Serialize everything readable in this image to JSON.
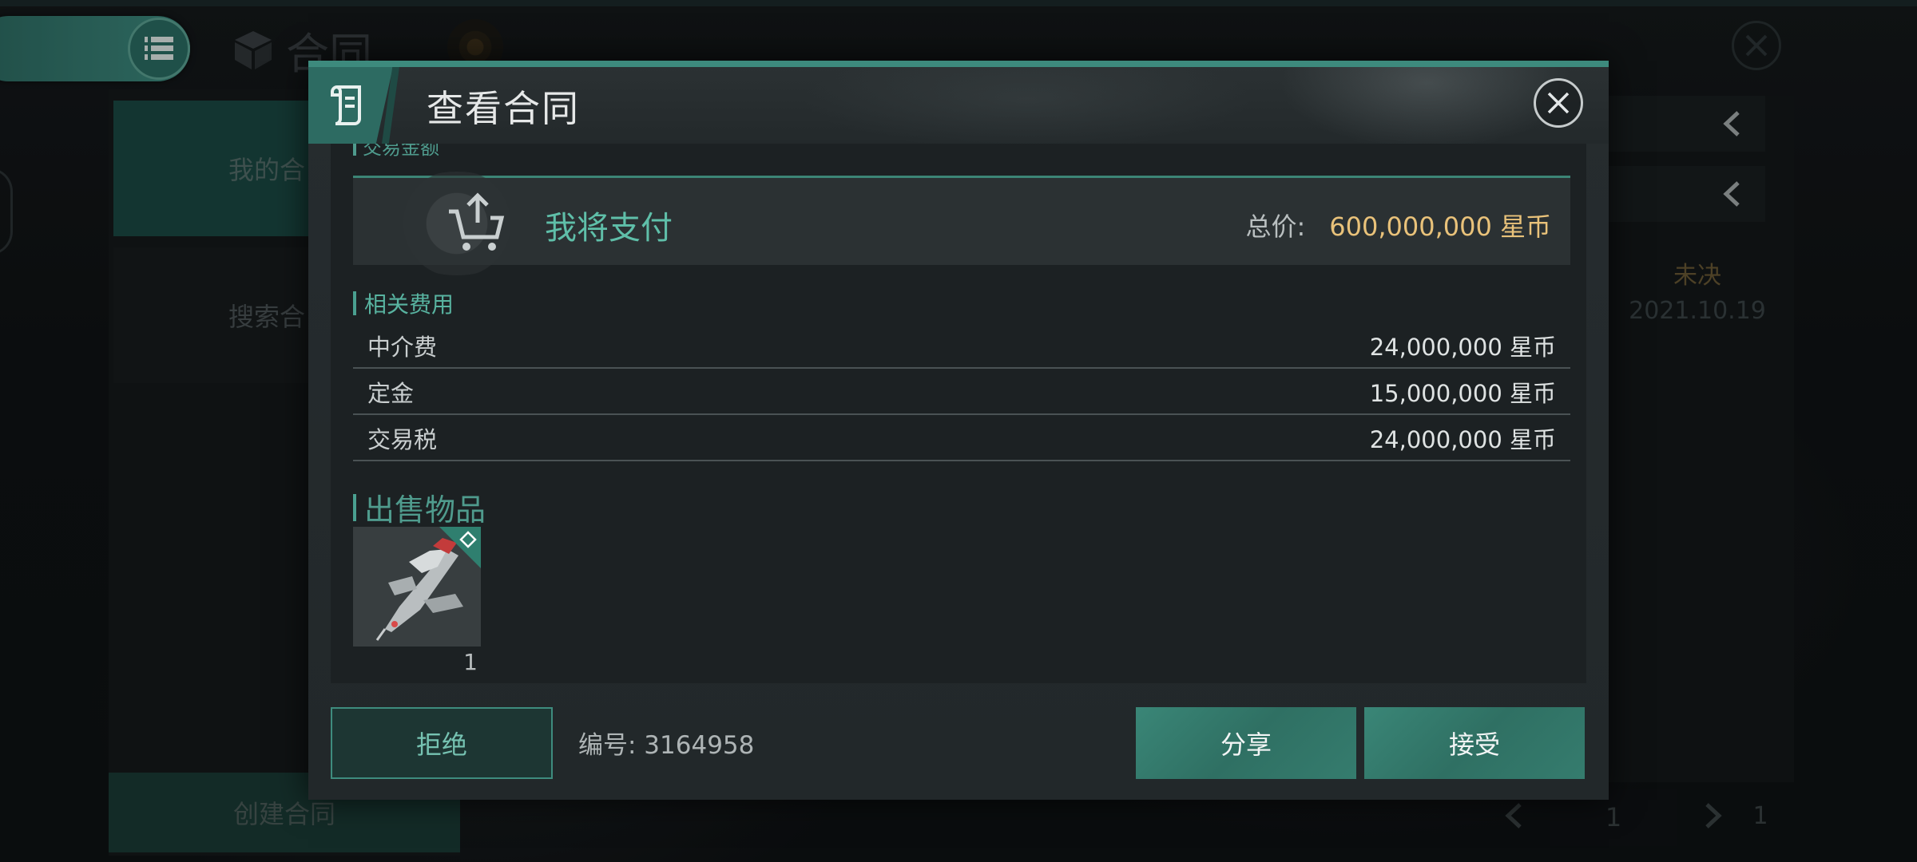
{
  "background": {
    "title": "合同",
    "sidebar": {
      "items": [
        {
          "label": "我的合"
        },
        {
          "label": "搜索合"
        }
      ],
      "create_label": "创建合同"
    },
    "right_column": {
      "status": "未决",
      "date": "2021.10.19"
    },
    "pager": {
      "current": "1",
      "total": "1"
    }
  },
  "dialog": {
    "title": "查看合同",
    "cut_heading": "交易金额",
    "payment": {
      "label": "我将支付",
      "total_label": "总价:",
      "total_value": "600,000,000 星币"
    },
    "fees": {
      "heading": "相关费用",
      "rows": [
        {
          "name": "中介费",
          "amount": "24,000,000 星币"
        },
        {
          "name": "定金",
          "amount": "15,000,000 星币"
        },
        {
          "name": "交易税",
          "amount": "24,000,000 星币"
        }
      ]
    },
    "items": {
      "heading": "出售物品",
      "list": [
        {
          "icon": "spaceship-icon",
          "quantity": "1"
        }
      ]
    },
    "footer": {
      "reject_label": "拒绝",
      "contract_number": "编号: 3164958",
      "share_label": "分享",
      "accept_label": "接受"
    }
  },
  "colors": {
    "accent_teal": "#3d8a7d",
    "price_gold": "#e9c27a",
    "label_teal": "#5fbfa9"
  }
}
